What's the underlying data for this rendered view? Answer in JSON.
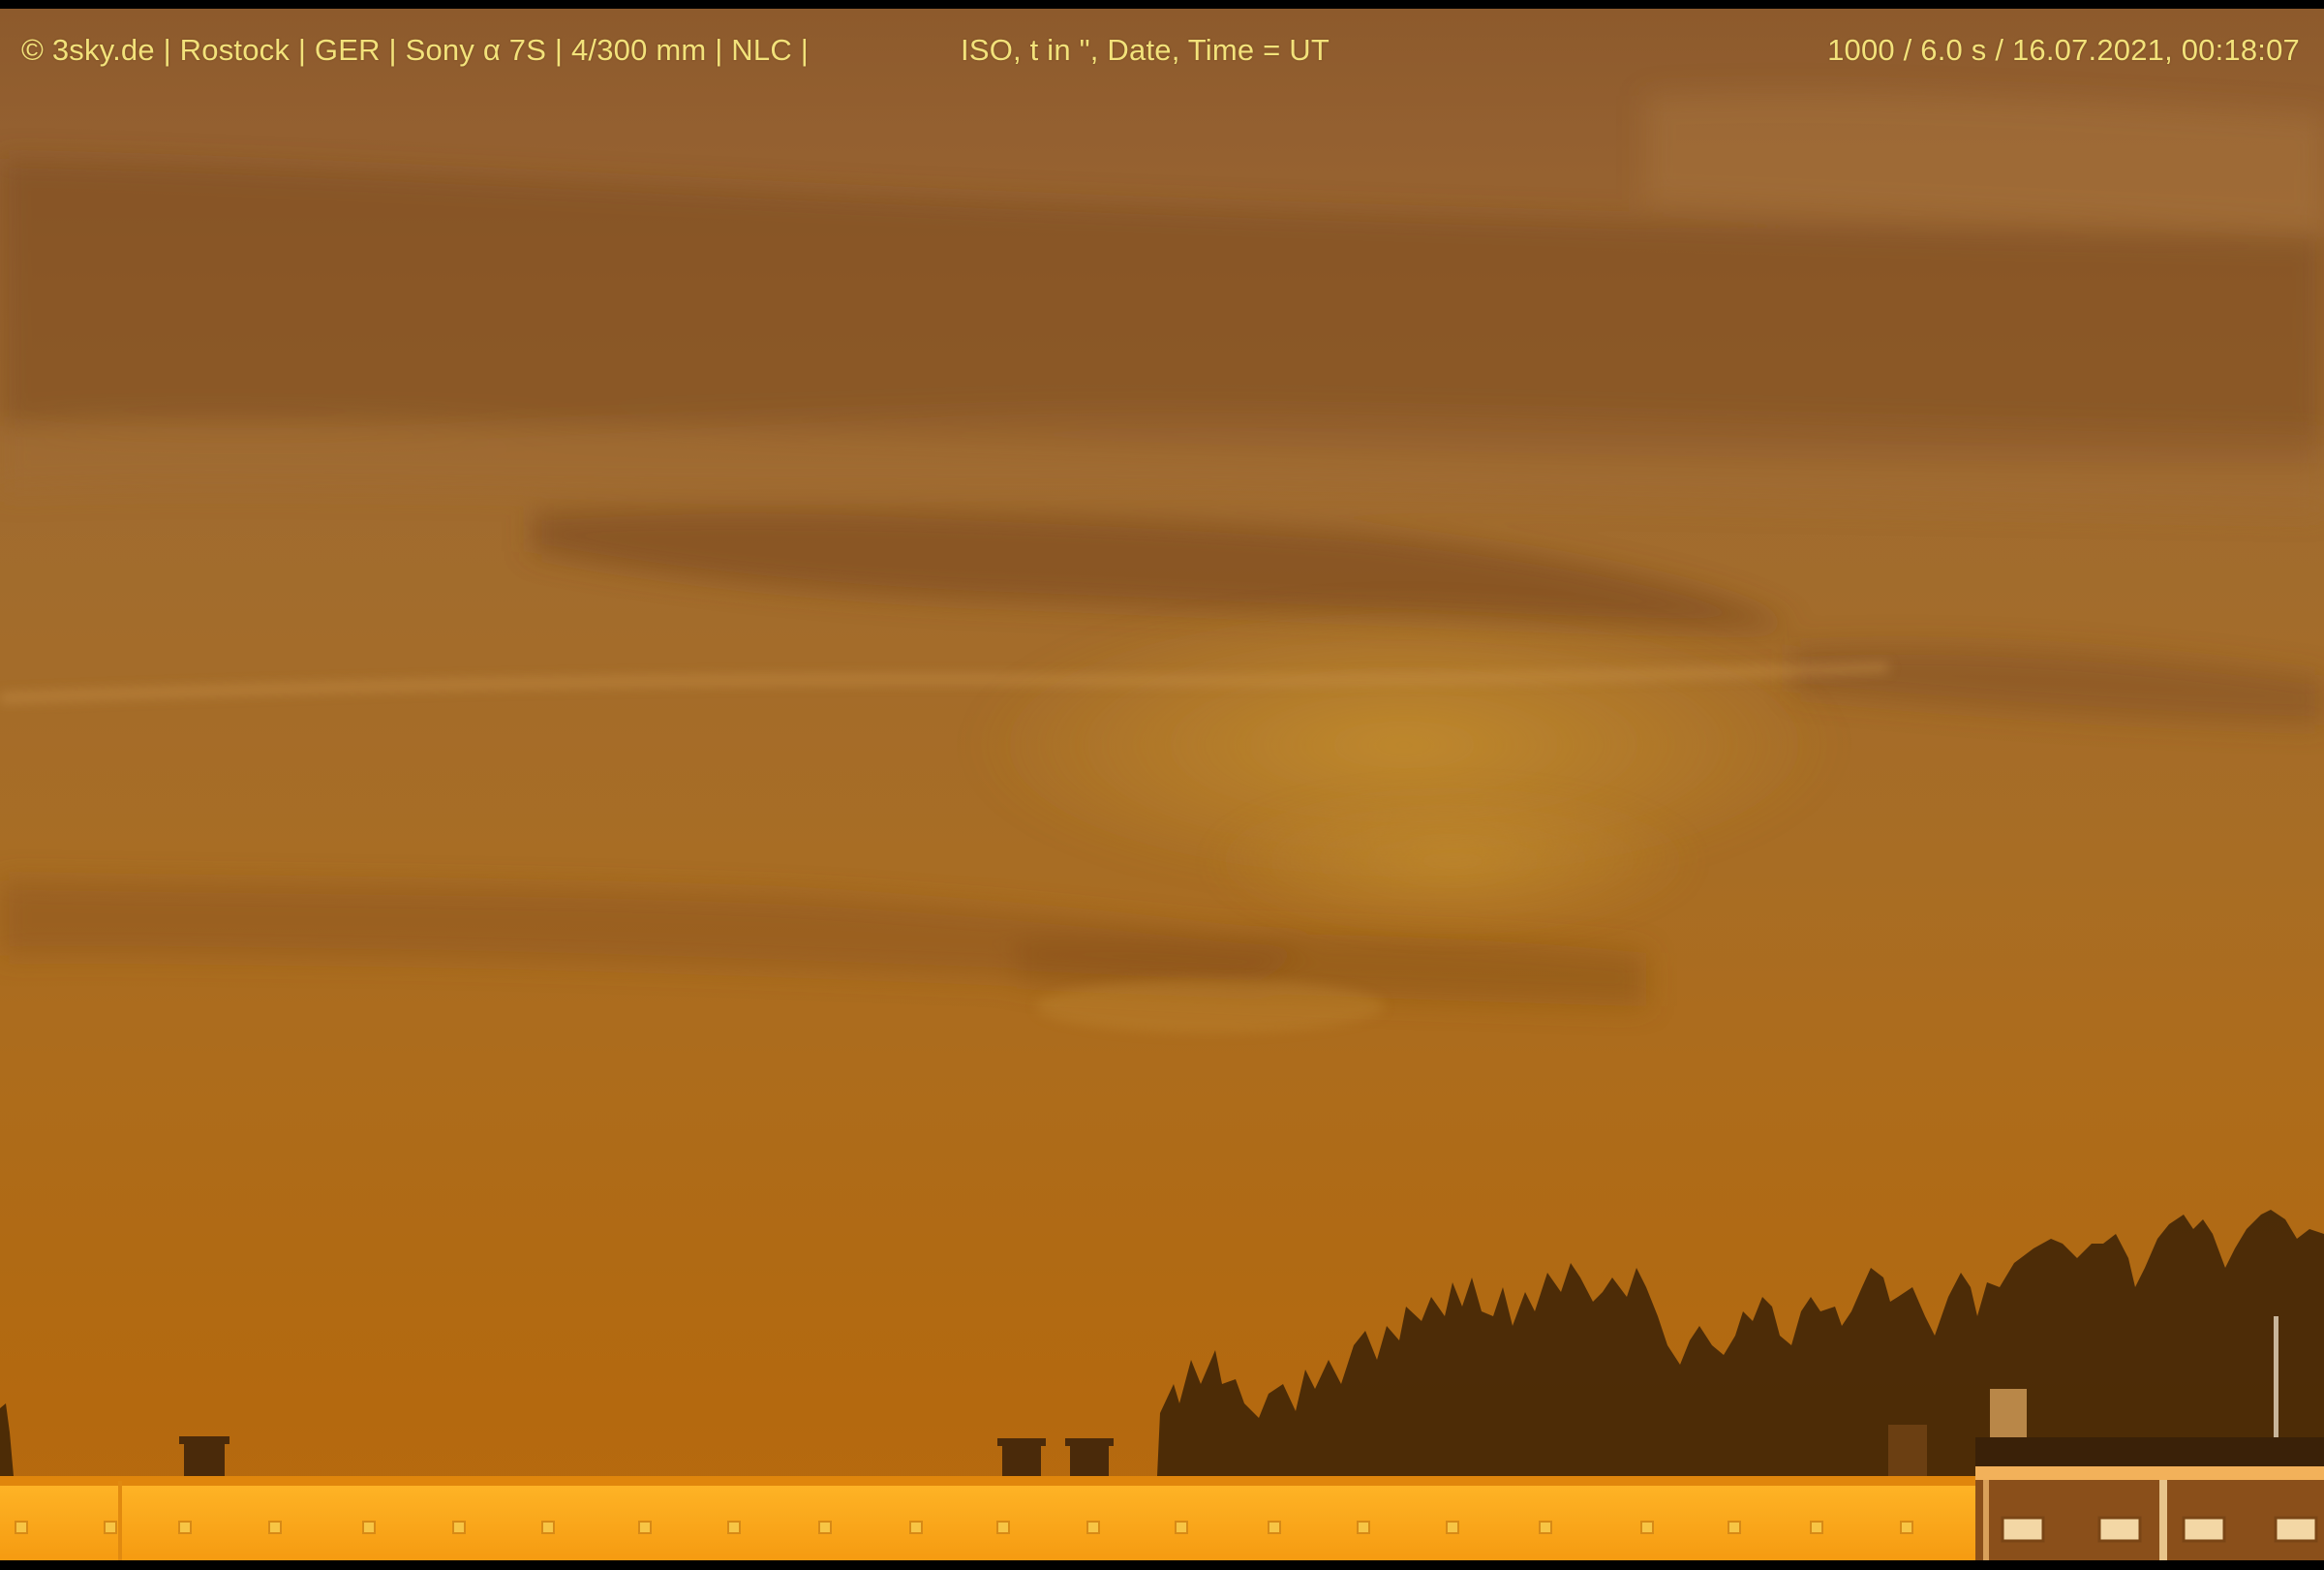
{
  "overlay": {
    "left_text": "© 3sky.de | Rostock | GER | Sony α 7S | 4/300 mm | NLC |",
    "center_text": "ISO, t in \", Date, Time = UT",
    "right_text": "1000 / 6.0 s / 16.07.2021, 00:18:07"
  },
  "scene": {
    "subject": "noctilucent-clouds",
    "sky_tone": "#a06b2f",
    "horizon_tone": "#b4690f",
    "building_tone": "#ffa61a",
    "tree_tone": "#3f2306"
  }
}
